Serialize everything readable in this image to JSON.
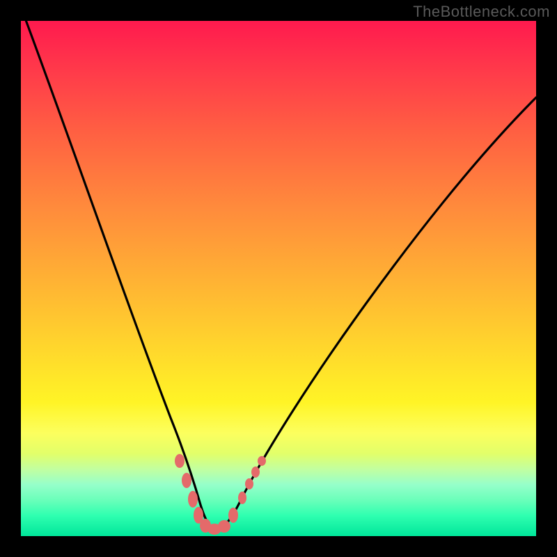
{
  "attribution": "TheBottleneck.com",
  "chart_data": {
    "type": "line",
    "title": "",
    "xlabel": "",
    "ylabel": "",
    "xlim": [
      0,
      100
    ],
    "ylim": [
      0,
      100
    ],
    "x": [
      0,
      5,
      10,
      15,
      20,
      25,
      28,
      30,
      32,
      34,
      36,
      38,
      40,
      45,
      50,
      55,
      60,
      65,
      70,
      75,
      80,
      85,
      90,
      95,
      100
    ],
    "values": [
      100,
      88,
      74,
      60,
      45,
      28,
      18,
      10,
      4,
      1,
      0,
      0,
      1,
      6,
      14,
      22,
      30,
      37,
      44,
      50,
      55,
      60,
      64,
      67,
      70
    ],
    "marker_points": [
      {
        "x": 29,
        "y": 13
      },
      {
        "x": 31,
        "y": 5
      },
      {
        "x": 33,
        "y": 2
      },
      {
        "x": 35,
        "y": 1
      },
      {
        "x": 37,
        "y": 1
      },
      {
        "x": 39,
        "y": 2
      },
      {
        "x": 41,
        "y": 4
      },
      {
        "x": 43,
        "y": 8
      },
      {
        "x": 45,
        "y": 12
      }
    ],
    "colors": {
      "curve": "#000000",
      "marker": "#e46a6a",
      "gradient_top": "#ff1a4e",
      "gradient_bottom": "#00e69a"
    }
  }
}
